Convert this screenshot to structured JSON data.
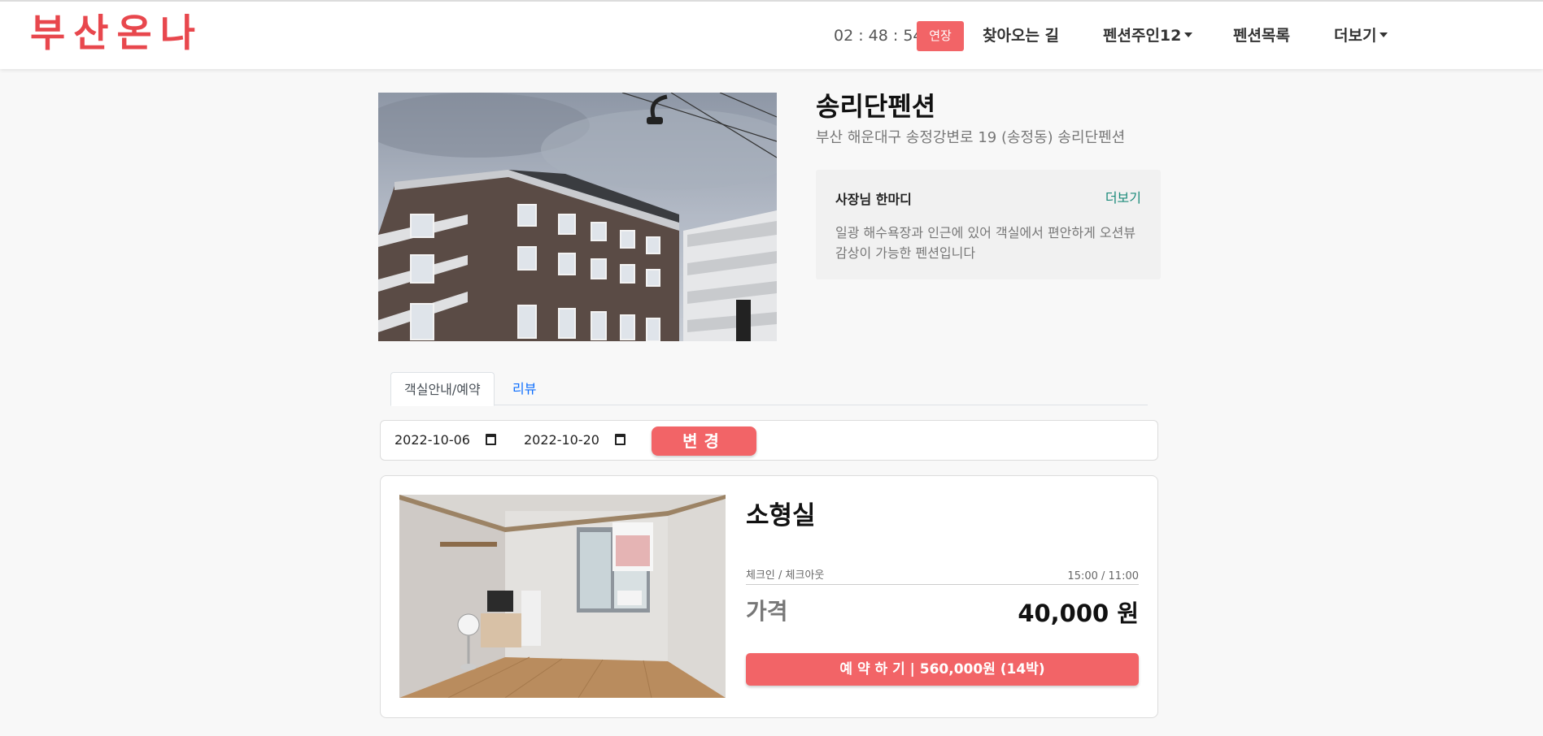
{
  "header": {
    "logo": "부산온나",
    "timer": "02 : 48 : 54",
    "extend_label": "연장",
    "nav": {
      "directions": "찾아오는 길",
      "owner_menu": "펜션주인12",
      "pension_list": "펜션목록",
      "more": "더보기"
    }
  },
  "pension": {
    "name": "송리단펜션",
    "address": "부산 해운대구 송정강변로 19 (송정동) 송리단펜션",
    "owner_note": {
      "title": "사장님 한마디",
      "more_label": "더보기",
      "text": "일광 해수욕장과 인근에 있어 객실에서 편안하게 오션뷰 감상이 가능한 펜션입니다"
    }
  },
  "tabs": [
    {
      "label": "객실안내/예약"
    },
    {
      "label": "리뷰"
    }
  ],
  "dates": {
    "checkin": "2022-10-06",
    "checkout": "2022-10-20",
    "change_label": "변경"
  },
  "room": {
    "name": "소형실",
    "check_label": "체크인 / 체크아웃",
    "check_value": "15:00 / 11:00",
    "price_label": "가격",
    "price_value": "40,000 원",
    "reserve_label": "예 약 하 기 | 560,000원 (14박)"
  },
  "colors": {
    "brand": "#e8474d",
    "button": "#f26467",
    "link": "#0d6efd",
    "more_link": "#1b8a7a"
  }
}
